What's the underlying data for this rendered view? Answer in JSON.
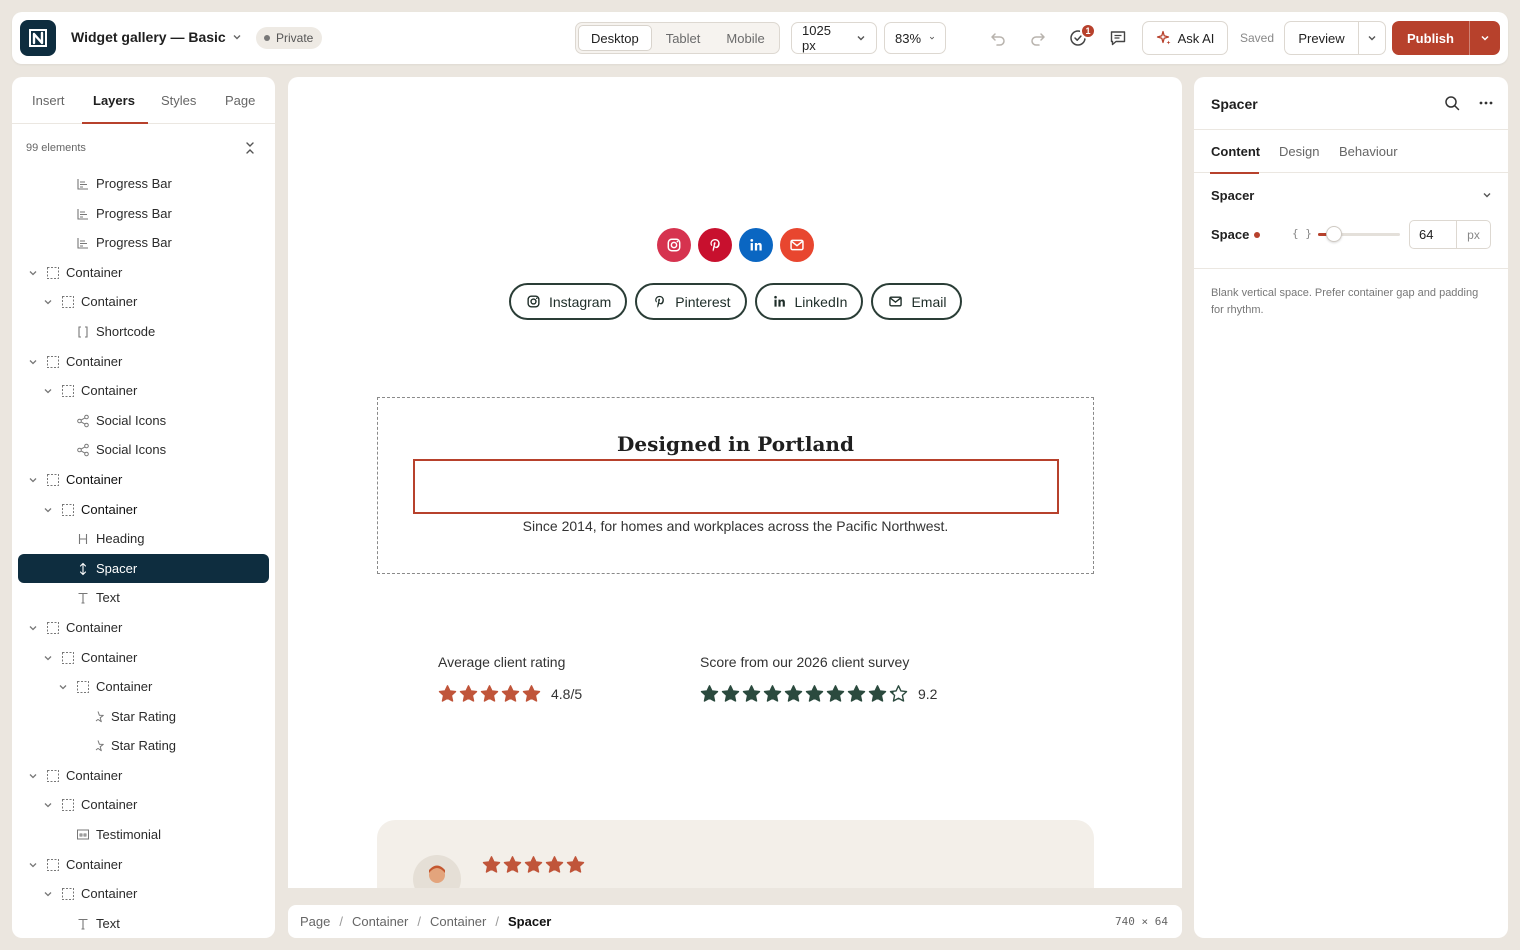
{
  "header": {
    "site_name": "Widget gallery — Basic",
    "privacy": "Private",
    "devices": [
      "Desktop",
      "Tablet",
      "Mobile"
    ],
    "active_device": "Desktop",
    "width": "1025 px",
    "zoom": "83%",
    "notification_count": "1",
    "ask_ai": "Ask AI",
    "saved_status": "Saved",
    "preview": "Preview",
    "publish": "Publish"
  },
  "left_panel": {
    "tabs": [
      "Insert",
      "Layers",
      "Styles",
      "Page"
    ],
    "active_tab": "Layers",
    "element_count": "99 elements",
    "layers": [
      {
        "label": "Progress Bar",
        "depth": 2,
        "icon": "progress-bar-icon"
      },
      {
        "label": "Progress Bar",
        "depth": 2,
        "icon": "progress-bar-icon"
      },
      {
        "label": "Progress Bar",
        "depth": 2,
        "icon": "progress-bar-icon"
      },
      {
        "label": "Container",
        "depth": 0,
        "icon": "container-icon",
        "expandable": true
      },
      {
        "label": "Container",
        "depth": 1,
        "icon": "container-icon",
        "expandable": true
      },
      {
        "label": "Shortcode",
        "depth": 2,
        "icon": "shortcode-icon"
      },
      {
        "label": "Container",
        "depth": 0,
        "icon": "container-icon",
        "expandable": true
      },
      {
        "label": "Container",
        "depth": 1,
        "icon": "container-icon",
        "expandable": true
      },
      {
        "label": "Social Icons",
        "depth": 2,
        "icon": "share-icon"
      },
      {
        "label": "Social Icons",
        "depth": 2,
        "icon": "share-icon"
      },
      {
        "label": "Container",
        "depth": 0,
        "icon": "container-icon",
        "expandable": true,
        "bold": true
      },
      {
        "label": "Container",
        "depth": 1,
        "icon": "container-icon",
        "expandable": true,
        "bold": true
      },
      {
        "label": "Heading",
        "depth": 2,
        "icon": "heading-icon"
      },
      {
        "label": "Spacer",
        "depth": 2,
        "icon": "spacer-icon",
        "selected": true
      },
      {
        "label": "Text",
        "depth": 2,
        "icon": "text-icon"
      },
      {
        "label": "Container",
        "depth": 0,
        "icon": "container-icon",
        "expandable": true
      },
      {
        "label": "Container",
        "depth": 1,
        "icon": "container-icon",
        "expandable": true
      },
      {
        "label": "Container",
        "depth": 2,
        "icon": "container-icon",
        "expandable": true
      },
      {
        "label": "Star Rating",
        "depth": 3,
        "icon": "star-rating-icon"
      },
      {
        "label": "Star Rating",
        "depth": 3,
        "icon": "star-rating-icon"
      },
      {
        "label": "Container",
        "depth": 0,
        "icon": "container-icon",
        "expandable": true
      },
      {
        "label": "Container",
        "depth": 1,
        "icon": "container-icon",
        "expandable": true
      },
      {
        "label": "Testimonial",
        "depth": 2,
        "icon": "testimonial-icon"
      },
      {
        "label": "Container",
        "depth": 0,
        "icon": "container-icon",
        "expandable": true
      },
      {
        "label": "Container",
        "depth": 1,
        "icon": "container-icon",
        "expandable": true
      },
      {
        "label": "Text",
        "depth": 2,
        "icon": "text-icon"
      }
    ]
  },
  "canvas": {
    "social_circles": [
      {
        "icon": "instagram-icon",
        "color": "#d6334f"
      },
      {
        "icon": "pinterest-icon",
        "color": "#c8102e"
      },
      {
        "icon": "linkedin-icon",
        "color": "#0a66c2"
      },
      {
        "icon": "email-icon",
        "color": "#e8462f"
      }
    ],
    "social_buttons": [
      {
        "label": "Instagram",
        "icon": "instagram-icon"
      },
      {
        "label": "Pinterest",
        "icon": "pinterest-icon"
      },
      {
        "label": "LinkedIn",
        "icon": "linkedin-icon"
      },
      {
        "label": "Email",
        "icon": "email-icon"
      }
    ],
    "heading": "Designed in Portland",
    "subtext": "Since 2014, for homes and workplaces across the Pacific Northwest.",
    "ratings": [
      {
        "label": "Average client rating",
        "value": "4.8/5",
        "rating": 4.8,
        "max": 5,
        "color": "#c0553a"
      },
      {
        "label": "Score from our 2026 client survey",
        "value": "9.2",
        "rating": 9.2,
        "max": 10,
        "color": "#2b4a3e"
      }
    ],
    "testimonial_stars": 5
  },
  "breadcrumb": {
    "items": [
      "Page",
      "Container",
      "Container",
      "Spacer"
    ],
    "dims": "740 × 64"
  },
  "right_panel": {
    "title": "Spacer",
    "tabs": [
      "Content",
      "Design",
      "Behaviour"
    ],
    "active_tab": "Content",
    "section": "Spacer",
    "space_label": "Space",
    "space_value": "64",
    "space_unit": "px",
    "slider_fraction": 0.2,
    "description": "Blank vertical space. Prefer container gap and padding for rhythm."
  },
  "colors": {
    "accent": "#b7412c",
    "navy": "#0e2d3f"
  }
}
